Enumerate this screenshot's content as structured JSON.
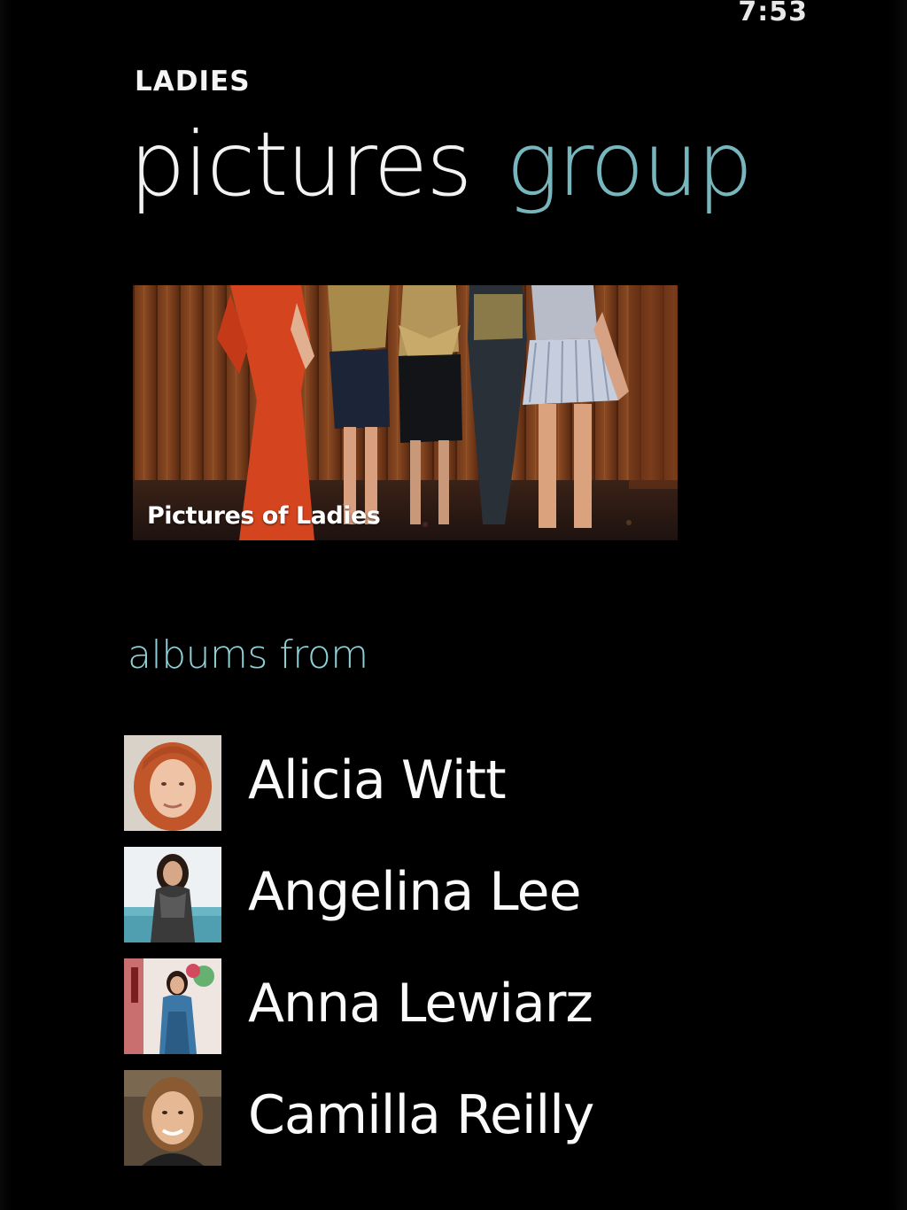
{
  "status_bar": {
    "time": "7:53"
  },
  "app": {
    "title": "LADIES"
  },
  "pivot": {
    "active": "pictures",
    "next": "group"
  },
  "hero_tile": {
    "caption": "Pictures of Ladies"
  },
  "albums_section": {
    "header": "albums from",
    "items": [
      {
        "name": "Alicia Witt"
      },
      {
        "name": "Angelina Lee"
      },
      {
        "name": "Anna Lewiarz"
      },
      {
        "name": "Camilla Reilly"
      }
    ]
  },
  "colors": {
    "background": "#000000",
    "accent_inactive_pivot": "#78b6bd",
    "section_header": "#8ed0d6",
    "text_primary": "#f3f3f3"
  }
}
